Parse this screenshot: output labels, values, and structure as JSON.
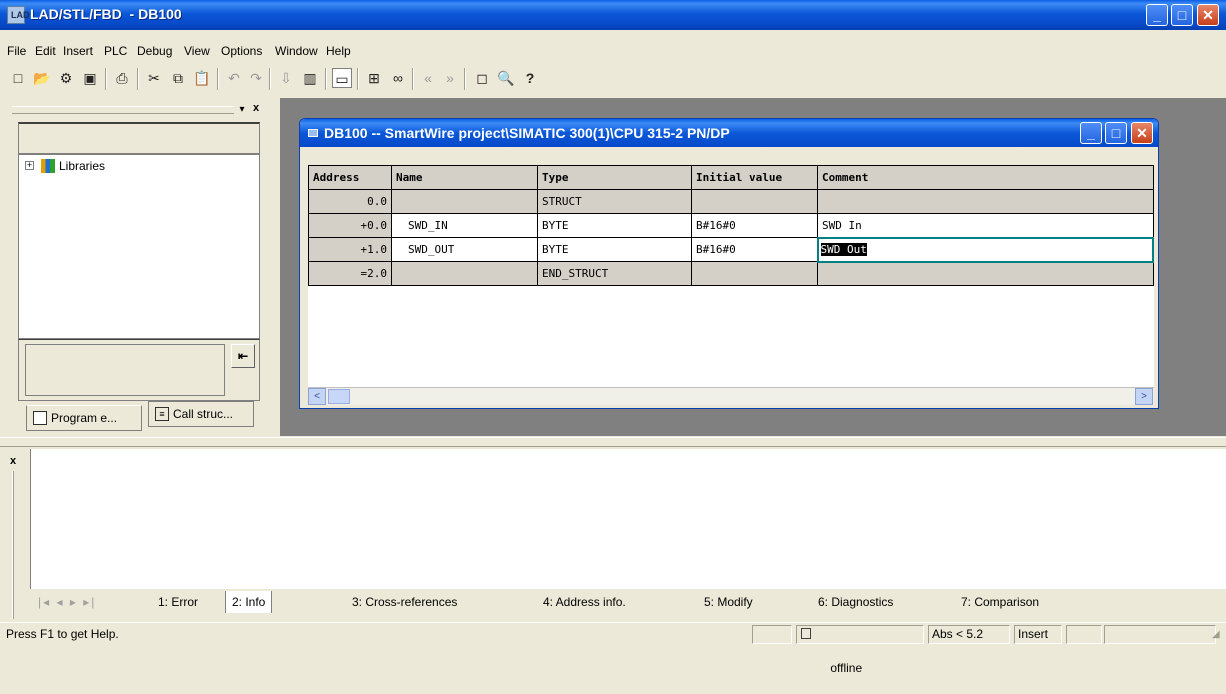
{
  "window": {
    "title": "LAD/STL/FBD  - DB100",
    "app_icon_text": "LAD",
    "minimize_label": "_",
    "maximize_label": "□",
    "close_label": "✕"
  },
  "menu": [
    "File",
    "Edit",
    "Insert",
    "PLC",
    "Debug",
    "View",
    "Options",
    "Window",
    "Help"
  ],
  "left_pane": {
    "tree_item": "Libraries",
    "expand_symbol": "+",
    "close_label": "x",
    "nav_arrow": "⇤",
    "tabs": [
      "Program e...",
      "Call struc..."
    ]
  },
  "document": {
    "title": "DB100 -- SmartWire project\\SIMATIC 300(1)\\CPU 315-2 PN/DP",
    "columns": [
      "Address",
      "Name",
      "Type",
      "Initial value",
      "Comment"
    ],
    "rows": [
      {
        "address": "0.0",
        "name": "",
        "type": "STRUCT",
        "initial": "",
        "comment": ""
      },
      {
        "address": "+0.0",
        "name": "SWD_IN",
        "type": "BYTE",
        "initial": "B#16#0",
        "comment": "SWD In"
      },
      {
        "address": "+1.0",
        "name": "SWD_OUT",
        "type": "BYTE",
        "initial": "B#16#0",
        "comment": "SWD Out"
      },
      {
        "address": "=2.0",
        "name": "",
        "type": "END_STRUCT",
        "initial": "",
        "comment": ""
      }
    ],
    "scroll_left": "<",
    "scroll_right": ">"
  },
  "output": {
    "close_label": "x",
    "tabs": [
      "1: Error",
      "2: Info",
      "3: Cross-references",
      "4: Address info.",
      "5: Modify",
      "6: Diagnostics",
      "7: Comparison"
    ]
  },
  "status": {
    "help_text": "Press F1 to get Help.",
    "connection": "offline",
    "position": "Abs < 5.2",
    "mode": "Insert"
  }
}
